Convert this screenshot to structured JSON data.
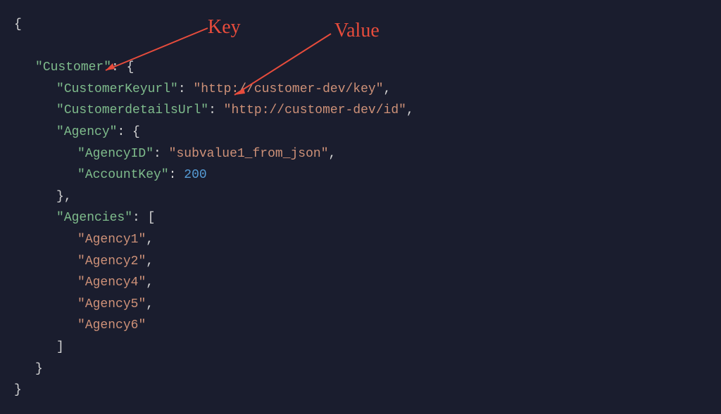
{
  "annotations": {
    "key_label": "Key",
    "value_label": "Value"
  },
  "code": {
    "open_brace": "{",
    "close_brace": "}",
    "open_bracket": "[",
    "close_bracket": "]",
    "colon": ":",
    "comma": ",",
    "quote": "\"",
    "customer_key": "Customer",
    "customerkeyurl_key": "CustomerKeyurl",
    "customerkeyurl_value": "http://customer-dev/key",
    "customerdetailsurl_key": "CustomerdetailsUrl",
    "customerdetailsurl_value": "http://customer-dev/id",
    "agency_key": "Agency",
    "agencyid_key": "AgencyID",
    "agencyid_value": "subvalue1_from_json",
    "accountkey_key": "AccountKey",
    "accountkey_value": "200",
    "agencies_key": "Agencies",
    "agencies_items": {
      "item1": "Agency1",
      "item2": "Agency2",
      "item3": "Agency4",
      "item4": "Agency5",
      "item5": "Agency6"
    }
  }
}
